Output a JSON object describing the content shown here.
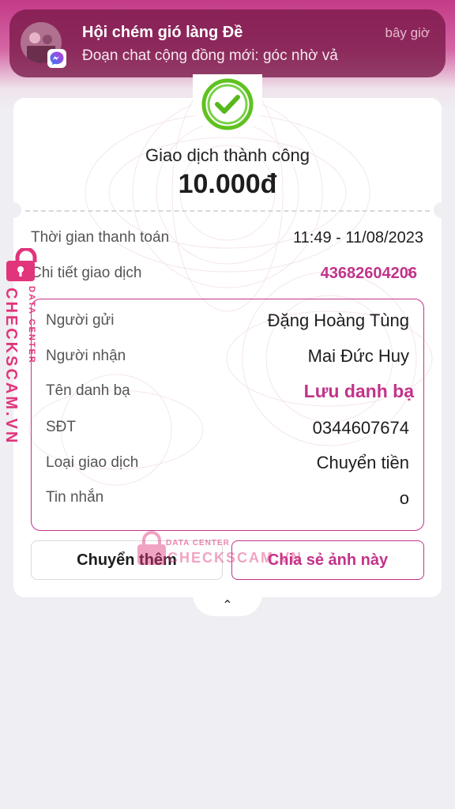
{
  "notification": {
    "title": "Hội chém gió làng Đề",
    "body": "Đoạn chat cộng đồng mới: góc nhờ vả",
    "time": "bây giờ",
    "app_icon": "messenger-icon"
  },
  "receipt": {
    "status": "Giao dịch thành công",
    "amount": "10.000đ",
    "status_icon": "check-circle-icon",
    "payment_time_label": "Thời gian thanh toán",
    "payment_time_value": "11:49 - 11/08/2023",
    "detail_label": "Chi tiết giao dịch",
    "transaction_id": "43682604206",
    "details": {
      "sender_label": "Người gửi",
      "sender_value": "Đặng Hoàng Tùng",
      "recipient_label": "Người nhận",
      "recipient_value": "Mai Đức Huy",
      "contact_label": "Tên danh bạ",
      "contact_value": "Lưu danh bạ",
      "phone_label": "SĐT",
      "phone_value": "0344607674",
      "type_label": "Loại giao dịch",
      "type_value": "Chuyển tiền",
      "message_label": "Tin nhắn",
      "message_value": "o"
    },
    "buttons": {
      "transfer_more": "Chuyển thêm",
      "share_image": "Chia sẻ ảnh này"
    }
  },
  "watermark": {
    "brand": "CHECKSCAM.VN",
    "sub": "DATA CENTER",
    "center_brand": "CHECKSCAM.VN",
    "center_sub": "DATA CENTER"
  },
  "colors": {
    "accent": "#c2338a",
    "success": "#52c41a",
    "watermark": "#e0357b"
  }
}
